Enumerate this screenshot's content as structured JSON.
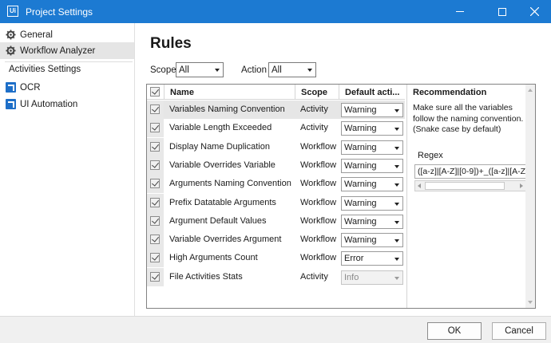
{
  "window": {
    "app_icon": "Ui",
    "title": "Project Settings",
    "title_bar_color": "#1c7ad2"
  },
  "sidebar": {
    "general_label": "General",
    "analyzer_label": "Workflow Analyzer",
    "activities_header": "Activities Settings",
    "ocr_label": "OCR",
    "ui_automation_label": "UI Automation"
  },
  "main": {
    "heading": "Rules",
    "scope_label": "Scope",
    "scope_value": "All",
    "action_label": "Action",
    "action_value": "All"
  },
  "grid": {
    "columns": {
      "name": "Name",
      "scope": "Scope",
      "default_action": "Default acti..."
    },
    "rows": [
      {
        "name": "Variables Naming Convention",
        "scope": "Activity",
        "action": "Warning",
        "enabled": true
      },
      {
        "name": "Variable Length Exceeded",
        "scope": "Activity",
        "action": "Warning",
        "enabled": true
      },
      {
        "name": "Display Name Duplication",
        "scope": "Workflow",
        "action": "Warning",
        "enabled": true
      },
      {
        "name": "Variable Overrides Variable",
        "scope": "Workflow",
        "action": "Warning",
        "enabled": true
      },
      {
        "name": "Arguments Naming Convention",
        "scope": "Workflow",
        "action": "Warning",
        "enabled": true
      },
      {
        "name": "Prefix Datatable Arguments",
        "scope": "Workflow",
        "action": "Warning",
        "enabled": true
      },
      {
        "name": "Argument Default Values",
        "scope": "Workflow",
        "action": "Warning",
        "enabled": true
      },
      {
        "name": "Variable Overrides Argument",
        "scope": "Workflow",
        "action": "Warning",
        "enabled": true
      },
      {
        "name": "High Arguments Count",
        "scope": "Workflow",
        "action": "Error",
        "enabled": true
      },
      {
        "name": "File Activities Stats",
        "scope": "Activity",
        "action": "Info",
        "enabled": false
      }
    ]
  },
  "recommendation": {
    "title": "Recommendation",
    "description": "Make sure all the variables follow the naming convention. (Snake case by default)",
    "regex_label": "Regex",
    "regex_value": "([a-z]|[A-Z]|[0-9])+_([a-z]|[A-Z"
  },
  "footer": {
    "ok_label": "OK",
    "cancel_label": "Cancel"
  }
}
